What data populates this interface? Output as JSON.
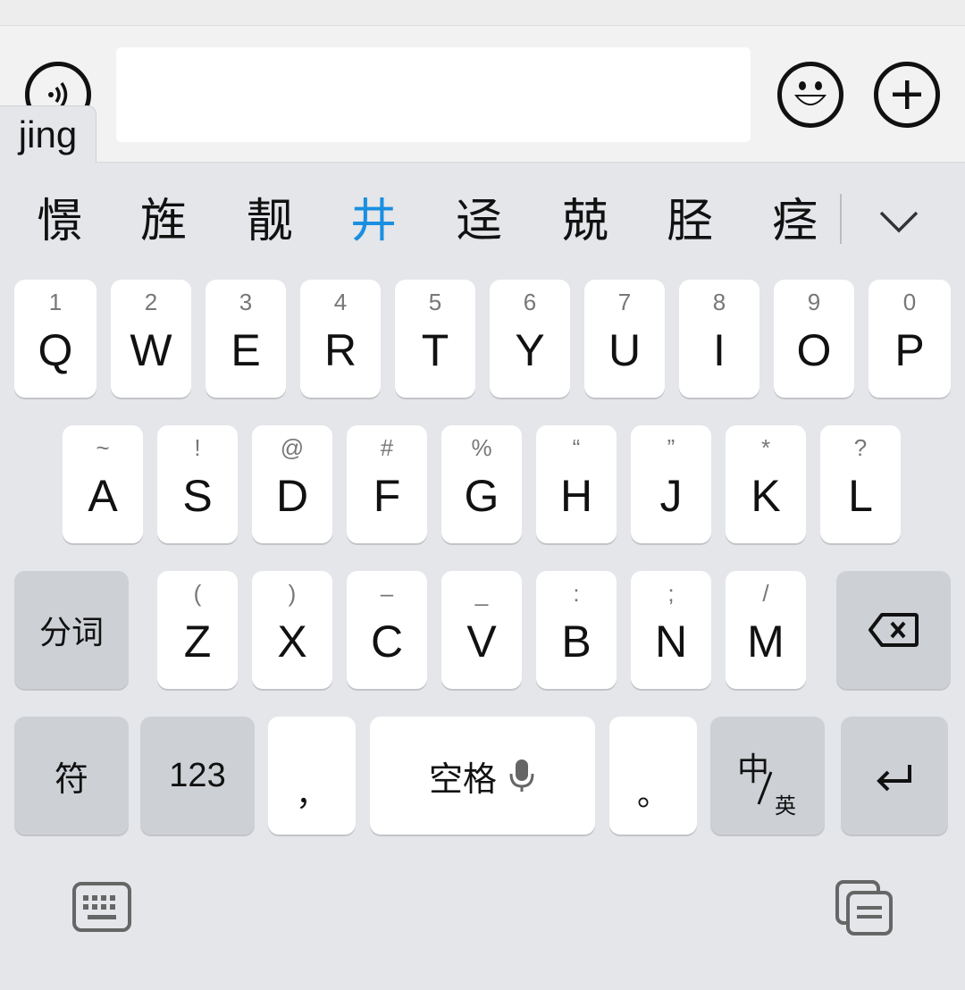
{
  "input": {
    "pinyin": "jing",
    "text_value": ""
  },
  "candidates": {
    "items": [
      "憬",
      "旌",
      "靓",
      "井",
      "迳",
      "兢",
      "胫",
      "痉"
    ],
    "active_index": 3,
    "active_color": "#1a8fe0"
  },
  "keyboard": {
    "row1": [
      {
        "letter": "Q",
        "hint": "1"
      },
      {
        "letter": "W",
        "hint": "2"
      },
      {
        "letter": "E",
        "hint": "3"
      },
      {
        "letter": "R",
        "hint": "4"
      },
      {
        "letter": "T",
        "hint": "5"
      },
      {
        "letter": "Y",
        "hint": "6"
      },
      {
        "letter": "U",
        "hint": "7"
      },
      {
        "letter": "I",
        "hint": "8"
      },
      {
        "letter": "O",
        "hint": "9"
      },
      {
        "letter": "P",
        "hint": "0"
      }
    ],
    "row2": [
      {
        "letter": "A",
        "hint": "~"
      },
      {
        "letter": "S",
        "hint": "!"
      },
      {
        "letter": "D",
        "hint": "@"
      },
      {
        "letter": "F",
        "hint": "#"
      },
      {
        "letter": "G",
        "hint": "%"
      },
      {
        "letter": "H",
        "hint": "“"
      },
      {
        "letter": "J",
        "hint": "”"
      },
      {
        "letter": "K",
        "hint": "*"
      },
      {
        "letter": "L",
        "hint": "?"
      }
    ],
    "row3": [
      {
        "letter": "Z",
        "hint": "("
      },
      {
        "letter": "X",
        "hint": ")"
      },
      {
        "letter": "C",
        "hint": "–"
      },
      {
        "letter": "V",
        "hint": "_"
      },
      {
        "letter": "B",
        "hint": ":"
      },
      {
        "letter": "N",
        "hint": ";"
      },
      {
        "letter": "M",
        "hint": "/"
      }
    ],
    "segment_label": "分词",
    "symbols_label": "符",
    "numbers_label": "123",
    "comma_label": "，",
    "space_label": "空格",
    "period_label": "。",
    "lang_zh_label": "中",
    "lang_en_label": "英"
  },
  "icons": {
    "voice": "voice-wave-icon",
    "emoji": "smiley-icon",
    "plus": "plus-icon",
    "more": "chevron-down-icon",
    "backspace": "backspace-icon",
    "enter": "enter-icon",
    "mic": "microphone-icon",
    "keyboard_toggle": "keyboard-icon",
    "clipboard": "clipboard-icon"
  }
}
